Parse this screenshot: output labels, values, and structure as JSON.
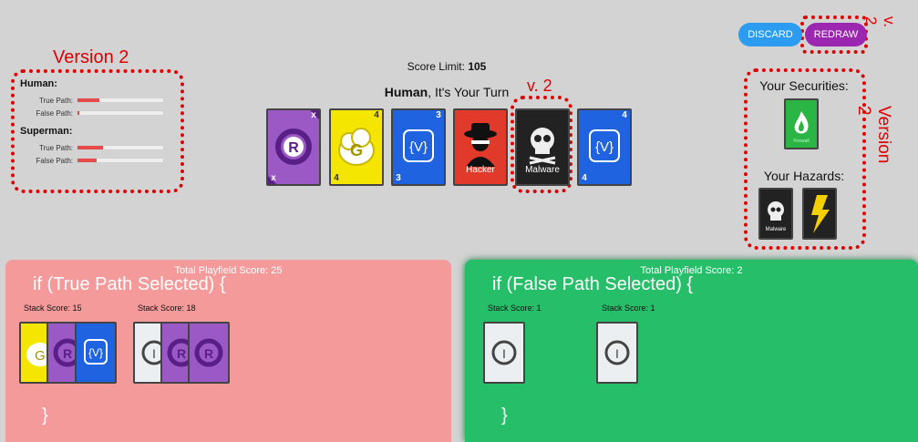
{
  "annotations": {
    "version2_left": "Version 2",
    "v2_center": "v. 2",
    "v2_top_right": "v. 2",
    "version2_right": "Version 2"
  },
  "players": [
    {
      "name": "Human:",
      "true_label": "True Path:",
      "false_label": "False Path:",
      "true_progress": 0.25,
      "false_progress": 0.02
    },
    {
      "name": "Superman:",
      "true_label": "True Path:",
      "false_label": "False Path:",
      "true_progress": 0.3,
      "false_progress": 0.22
    }
  ],
  "header": {
    "score_limit_label": "Score Limit:",
    "score_limit_value": "105",
    "turn_name": "Human",
    "turn_suffix": ", It's Your Turn"
  },
  "hand": [
    {
      "type": "R",
      "color": "#9b59c6",
      "corner": "x",
      "label": ""
    },
    {
      "type": "G",
      "color": "#f4e600",
      "corner": "4",
      "label": ""
    },
    {
      "type": "{V}",
      "color": "#1f63e0",
      "corner": "3",
      "label": ""
    },
    {
      "type": "hacker",
      "color": "#e23a2a",
      "corner": "",
      "label": "Hacker"
    },
    {
      "type": "skull",
      "color": "#222222",
      "corner": "",
      "label": "Malware"
    },
    {
      "type": "{V}",
      "color": "#1f63e0",
      "corner": "4",
      "label": ""
    }
  ],
  "buttons": {
    "discard": "DISCARD",
    "redraw": "REDRAW"
  },
  "sidebar": {
    "securities_title": "Your Securities:",
    "hazards_title": "Your Hazards:",
    "security_card_label": "Firewall",
    "hazard_card_1_label": "Malware",
    "hazard_card_2_label": "Power"
  },
  "fields": {
    "true": {
      "total": "Total Playfield Score: 25",
      "condition": "if (True Path Selected) {",
      "stack1": "Stack Score: 15",
      "stack2": "Stack Score: 18",
      "close": "}"
    },
    "false": {
      "total": "Total Playfield Score: 2",
      "condition": "if (False Path Selected) {",
      "stack1": "Stack Score: 1",
      "stack2": "Stack Score: 1",
      "close": "}"
    }
  },
  "colors": {
    "true_field": "#f59a9a",
    "false_field": "#27be6a",
    "discard": "#2b9cf0",
    "redraw": "#9b27b0",
    "annotation": "#e00000"
  }
}
